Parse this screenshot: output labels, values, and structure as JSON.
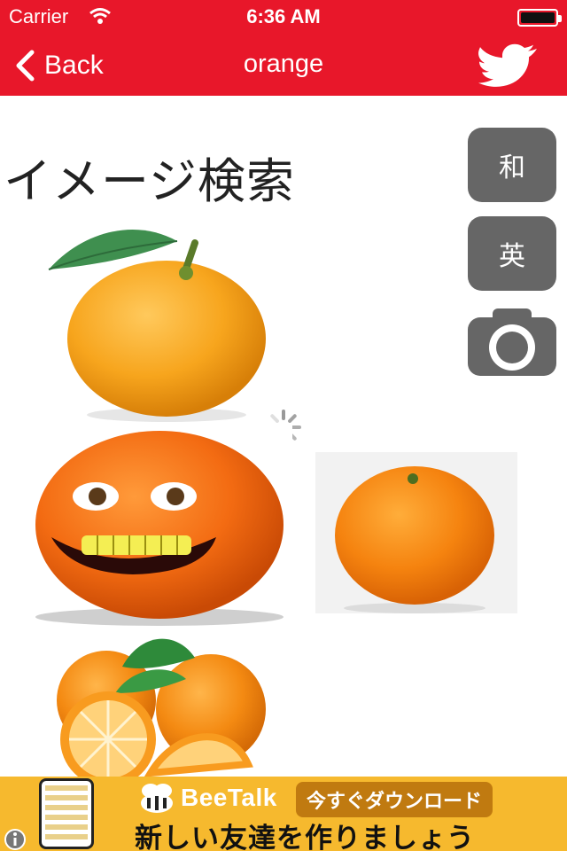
{
  "status_bar": {
    "carrier": "Carrier",
    "time": "6:36 AM"
  },
  "nav_bar": {
    "back_label": "Back",
    "title": "orange",
    "share_icon": "twitter-bird-icon"
  },
  "content": {
    "heading": "イメージ検索",
    "side_buttons": {
      "japanese_label": "和",
      "english_label": "英",
      "camera_icon": "camera-icon"
    }
  },
  "ad_banner": {
    "brand": "BeeTalk",
    "cta": "今すぐダウンロード",
    "slogan": "新しい友達を作りましょう",
    "info_icon": "info-icon"
  },
  "colors": {
    "accent_red": "#e8172a",
    "button_gray": "#666666",
    "ad_yellow": "#f6b92e"
  }
}
